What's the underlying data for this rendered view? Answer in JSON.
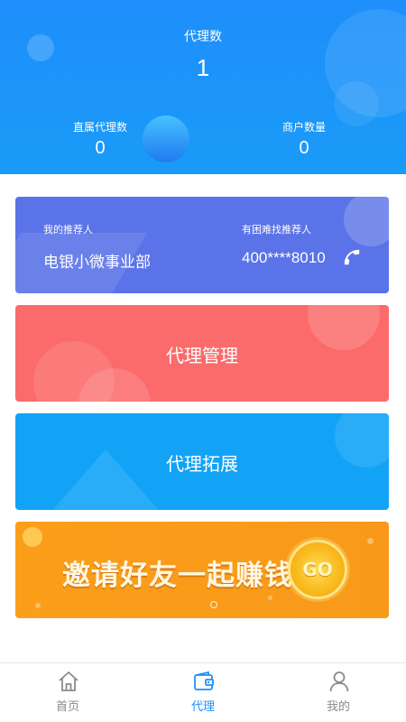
{
  "header": {
    "agent_count_label": "代理数",
    "agent_count_value": "1",
    "direct_agents_label": "直属代理数",
    "direct_agents_value": "0",
    "merchants_label": "商户数量",
    "merchants_value": "0"
  },
  "referrer": {
    "my_referrer_label": "我的推荐人",
    "my_referrer_name": "电银小微事业部",
    "help_label": "有困难找推荐人",
    "phone": "400****8010"
  },
  "cards": {
    "manage_label": "代理管理",
    "expand_label": "代理拓展"
  },
  "banner": {
    "text": "邀请好友一起赚钱",
    "go_label": "GO"
  },
  "nav": {
    "items": [
      {
        "label": "首页",
        "icon": "home-icon"
      },
      {
        "label": "代理",
        "icon": "wallet-icon"
      },
      {
        "label": "我的",
        "icon": "user-icon"
      }
    ],
    "active_color": "#1e8efb",
    "inactive_color": "#8a8a8a"
  },
  "colors": {
    "header": "#1e8efb",
    "referrer_card": "#5b73e8",
    "manage_card": "#fb6b6b",
    "expand_card": "#12a3f7",
    "banner": "#fb9f1a"
  }
}
